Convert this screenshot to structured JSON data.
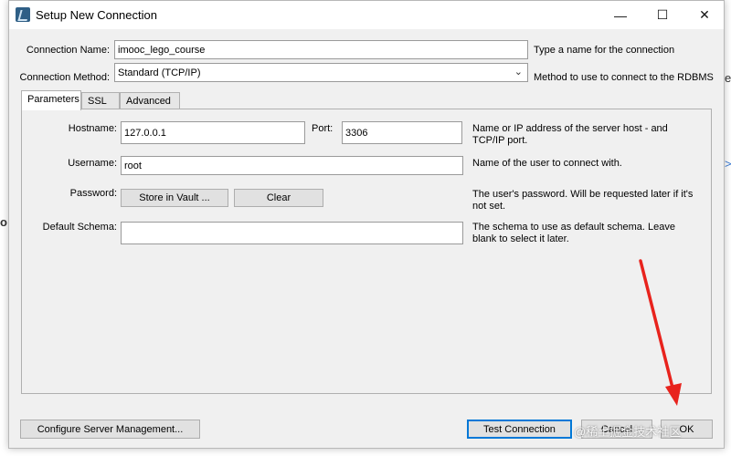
{
  "window": {
    "title": "Setup New Connection",
    "minimize_glyph": "—",
    "maximize_glyph": "☐",
    "close_glyph": "✕"
  },
  "connection_name": {
    "label": "Connection Name:",
    "value": "imooc_lego_course",
    "hint": "Type a name for the connection"
  },
  "connection_method": {
    "label": "Connection Method:",
    "value": "Standard (TCP/IP)",
    "hint": "Method to use to connect to the RDBMS"
  },
  "tabs": [
    {
      "label": "Parameters",
      "active": true
    },
    {
      "label": "SSL",
      "active": false
    },
    {
      "label": "Advanced",
      "active": false
    }
  ],
  "parameters": {
    "hostname_label": "Hostname:",
    "hostname_value": "127.0.0.1",
    "port_label": "Port:",
    "port_value": "3306",
    "hostname_hint": "Name or IP address of the server host - and TCP/IP port.",
    "username_label": "Username:",
    "username_value": "root",
    "username_hint": "Name of the user to connect with.",
    "password_label": "Password:",
    "store_in_vault": "Store in Vault ...",
    "clear": "Clear",
    "password_hint": "The user's password. Will be requested later if it's not set.",
    "schema_label": "Default Schema:",
    "schema_value": "",
    "schema_hint": "The schema to use as default schema. Leave blank to select it later."
  },
  "footer": {
    "configure": "Configure Server Management...",
    "test": "Test Connection",
    "cancel": "Cancel",
    "ok": "OK"
  },
  "background": {
    "frag_right_1": "e",
    "frag_right_2": ">",
    "frag_left": "o"
  },
  "watermark": "@稀土掘金技术社区",
  "annotation": {
    "color": "#e8231d"
  }
}
